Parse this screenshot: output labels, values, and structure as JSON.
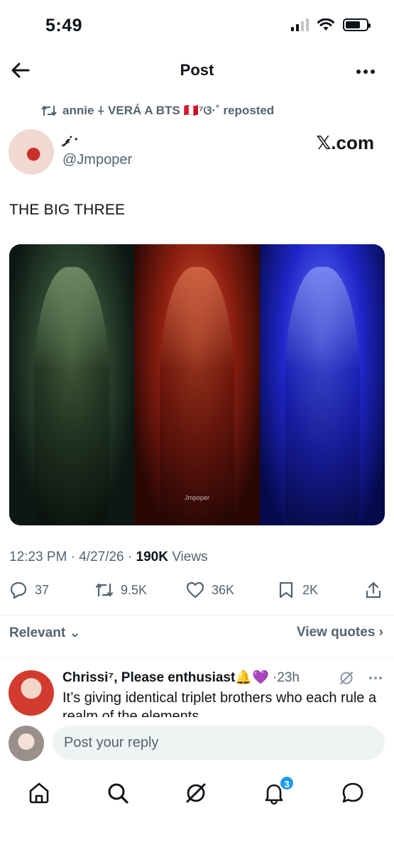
{
  "status_bar": {
    "time": "5:49"
  },
  "header": {
    "title": "Post"
  },
  "repost": {
    "text": "annie ⍭ VERÁ A BTS 🇵🇪⁷ଓ·˚ reposted"
  },
  "author": {
    "name": "𝒿 ·",
    "handle": "@Jmpoper",
    "source": "𝕏.com"
  },
  "post": {
    "text": "THE BIG THREE",
    "watermark": "Jmpoper",
    "time": "12:23 PM",
    "date": "4/27/26",
    "views_count": "190K",
    "views_label": "Views"
  },
  "actions": {
    "replies": "37",
    "reposts": "9.5K",
    "likes": "36K",
    "bookmarks": "2K"
  },
  "sort": {
    "relevant": "Relevant",
    "view_quotes": "View quotes"
  },
  "reply": {
    "name": "Chrissi⁷, Please enthusiast🔔💜",
    "time": "·23h",
    "text": "It’s giving identical triplet brothers who each rule a realm of the elements"
  },
  "compose": {
    "placeholder": "Post your reply"
  },
  "nav": {
    "notifications_badge": "3"
  },
  "colors": {
    "accent": "#1d9bf0",
    "secondary_text": "#536471"
  }
}
